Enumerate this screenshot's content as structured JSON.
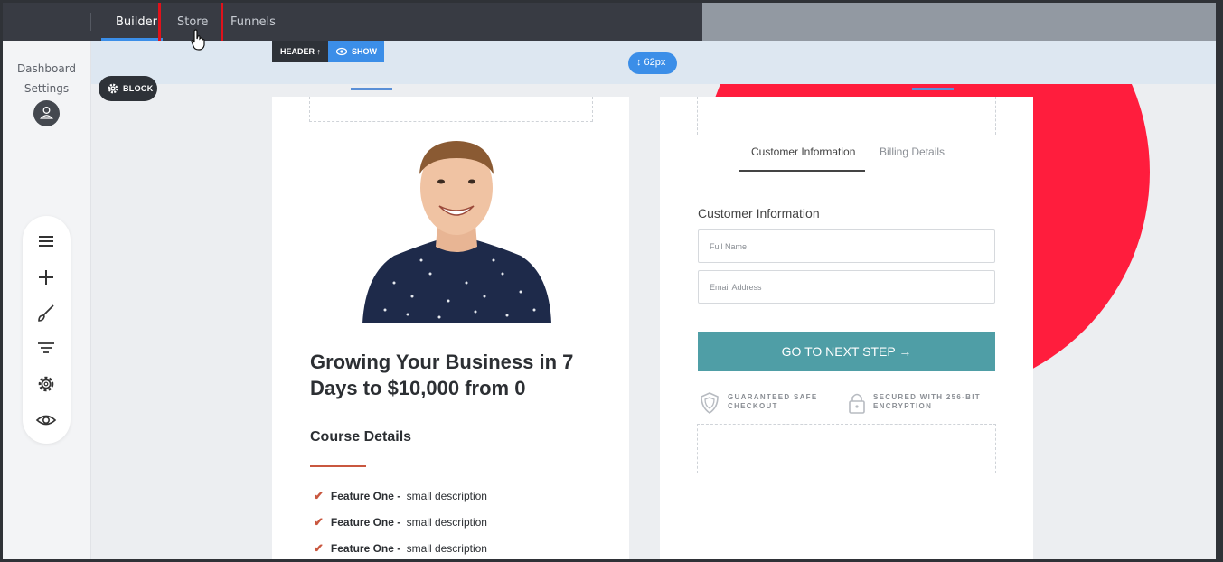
{
  "topnav": {
    "tabs": [
      {
        "label": "Builder",
        "active": true
      },
      {
        "label": "Store",
        "active": false
      },
      {
        "label": "Funnels",
        "active": false
      }
    ]
  },
  "sidebar": {
    "links": [
      "Dashboard",
      "Settings"
    ],
    "tools": [
      "menu-icon",
      "plus-icon",
      "brush-icon",
      "filter-icon",
      "gear-icon",
      "eye-icon"
    ]
  },
  "editor": {
    "block_label": "BLOCK",
    "header_label": "HEADER ↑",
    "show_label": "SHOW",
    "spacing_label": "↕ 62px"
  },
  "product": {
    "headline": "Growing Your Business in 7 Days to $10,000 from 0",
    "course_title": "Course Details",
    "features": [
      {
        "name": "Feature One -",
        "desc": "small description"
      },
      {
        "name": "Feature One -",
        "desc": "small description"
      },
      {
        "name": "Feature One -",
        "desc": "small description"
      }
    ]
  },
  "checkout": {
    "tabs": [
      "Customer Information",
      "Billing Details"
    ],
    "form_title": "Customer Information",
    "full_name_placeholder": "Full Name",
    "email_placeholder": "Email Address",
    "cta_label": "GO TO NEXT STEP →",
    "badges": [
      {
        "line1": "GUARANTEED SAFE",
        "line2": "CHECKOUT"
      },
      {
        "line1": "SECURED WITH 256-BIT",
        "line2": "ENCRYPTION"
      }
    ]
  },
  "colors": {
    "accent": "#3b8ee8",
    "cta": "#4f9ea6",
    "brand_red": "#ff1d3d",
    "highlight": "#e0121b",
    "check": "#c9573f"
  }
}
